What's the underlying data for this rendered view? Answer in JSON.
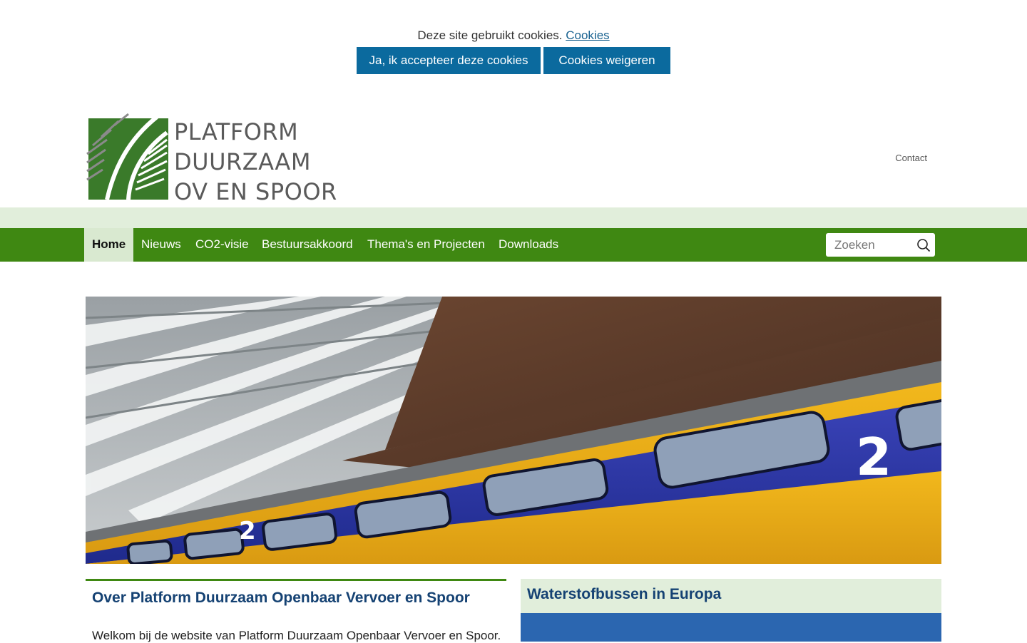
{
  "cookie": {
    "message": "Deze site gebruikt cookies.",
    "link": "Cookies",
    "accept_label": "Ja, ik accepteer deze cookies",
    "refuse_label": "Cookies weigeren"
  },
  "header": {
    "logo_line1": "PLATFORM",
    "logo_line2": "DUURZAAM",
    "logo_line3": "OV EN SPOOR",
    "contact": "Contact"
  },
  "nav": {
    "items": [
      {
        "label": "Home",
        "active": true
      },
      {
        "label": "Nieuws"
      },
      {
        "label": "CO2-visie"
      },
      {
        "label": "Bestuursakkoord"
      },
      {
        "label": "Thema's en Projecten"
      },
      {
        "label": "Downloads"
      }
    ],
    "search_placeholder": "Zoeken"
  },
  "main": {
    "left_title": "Over Platform Duurzaam Openbaar Vervoer en Spoor",
    "left_intro": "Welkom bij de website van Platform Duurzaam Openbaar Vervoer en Spoor.",
    "right_title": "Waterstofbussen in Europa"
  },
  "colors": {
    "nav_green": "#3f8812",
    "light_green": "#e1eedb",
    "cookie_blue": "#0b6a9e",
    "title_blue": "#154273"
  },
  "hero": {
    "train_number_large": "2",
    "train_number_small": "2"
  }
}
